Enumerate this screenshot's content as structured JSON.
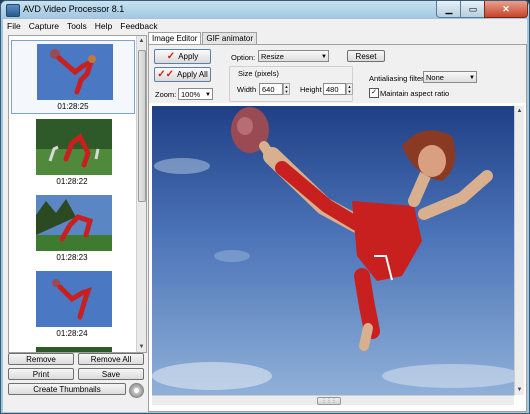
{
  "window": {
    "title": "AVD Video Processor 8.1"
  },
  "menu": [
    "File",
    "Capture",
    "Tools",
    "Help",
    "Feedback"
  ],
  "thumbnails": [
    {
      "time": "01:28:25",
      "selected": true
    },
    {
      "time": "01:28:22",
      "selected": false
    },
    {
      "time": "01:28:23",
      "selected": false
    },
    {
      "time": "01:28:24",
      "selected": false
    }
  ],
  "left_buttons": {
    "remove": "Remove",
    "remove_all": "Remove All",
    "print": "Print",
    "save": "Save",
    "create_thumbnails": "Create Thumbnails"
  },
  "tabs": [
    {
      "label": "Image Editor",
      "active": true
    },
    {
      "label": "GIF animator",
      "active": false
    }
  ],
  "editor": {
    "apply": "Apply",
    "apply_all": "Apply All",
    "zoom_label": "Zoom:",
    "zoom_value": "100%",
    "option_label": "Option:",
    "option_value": "Resize",
    "reset": "Reset",
    "size_label": "Size (pixels)",
    "width_label": "Width",
    "width_value": "640",
    "height_label": "Height",
    "height_value": "480",
    "antialias_label": "Antialiasing filter:",
    "antialias_value": "None",
    "maintain_aspect": "Maintain aspect ratio",
    "maintain_aspect_checked": true
  },
  "colors": {
    "sky_top": "#1f3f85",
    "sky_bottom": "#8fb0d8",
    "jersey": "#c8201e"
  }
}
